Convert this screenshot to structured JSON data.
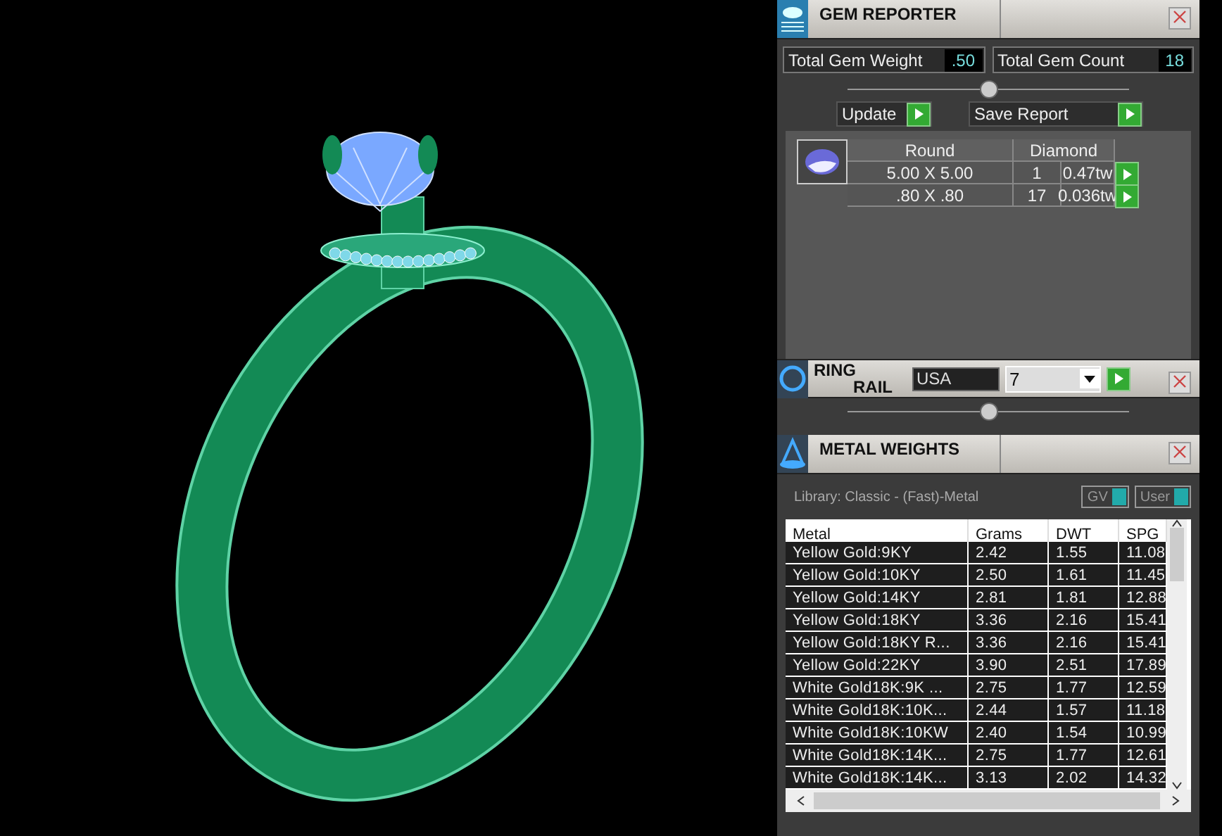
{
  "gem_reporter": {
    "title": "GEM REPORTER",
    "totals": [
      {
        "label": "Total Gem Weight",
        "value": ".50"
      },
      {
        "label": "Total Gem Count",
        "value": "18"
      }
    ],
    "buttons": [
      "Update",
      "Save Report"
    ],
    "table": {
      "columns": [
        "Round",
        "Diamond"
      ],
      "rows": [
        {
          "size": "5.00 X 5.00",
          "count": "1",
          "weight": "0.47tw"
        },
        {
          "size": ".80 X .80",
          "count": "17",
          "weight": "0.036tw"
        }
      ]
    }
  },
  "ring_rail": {
    "title_lines": [
      "RING",
      "RAIL"
    ],
    "standard": "USA",
    "size": "7"
  },
  "metal_weights": {
    "title": "METAL WEIGHTS",
    "library": "Library: Classic - (Fast)-Metal",
    "toggles": [
      {
        "label": "GV",
        "on": true
      },
      {
        "label": "User",
        "on": true
      }
    ],
    "columns": [
      "Metal",
      "Grams",
      "DWT",
      "SPG"
    ],
    "rows": [
      [
        "Yellow Gold:9KY",
        "2.42",
        "1.55",
        "11.08"
      ],
      [
        "Yellow Gold:10KY",
        "2.50",
        "1.61",
        "11.45"
      ],
      [
        "Yellow Gold:14KY",
        "2.81",
        "1.81",
        "12.88"
      ],
      [
        "Yellow Gold:18KY",
        "3.36",
        "2.16",
        "15.41"
      ],
      [
        "Yellow Gold:18KY R...",
        "3.36",
        "2.16",
        "15.41"
      ],
      [
        "Yellow Gold:22KY",
        "3.90",
        "2.51",
        "17.89"
      ],
      [
        "White Gold18K:9K ...",
        "2.75",
        "1.77",
        "12.59"
      ],
      [
        "White Gold18K:10K...",
        "2.44",
        "1.57",
        "11.18"
      ],
      [
        "White Gold18K:10KW",
        "2.40",
        "1.54",
        "10.99"
      ],
      [
        "White Gold18K:14K...",
        "2.75",
        "1.77",
        "12.61"
      ],
      [
        "White Gold18K:14K...",
        "3.13",
        "2.02",
        "14.32"
      ]
    ]
  }
}
